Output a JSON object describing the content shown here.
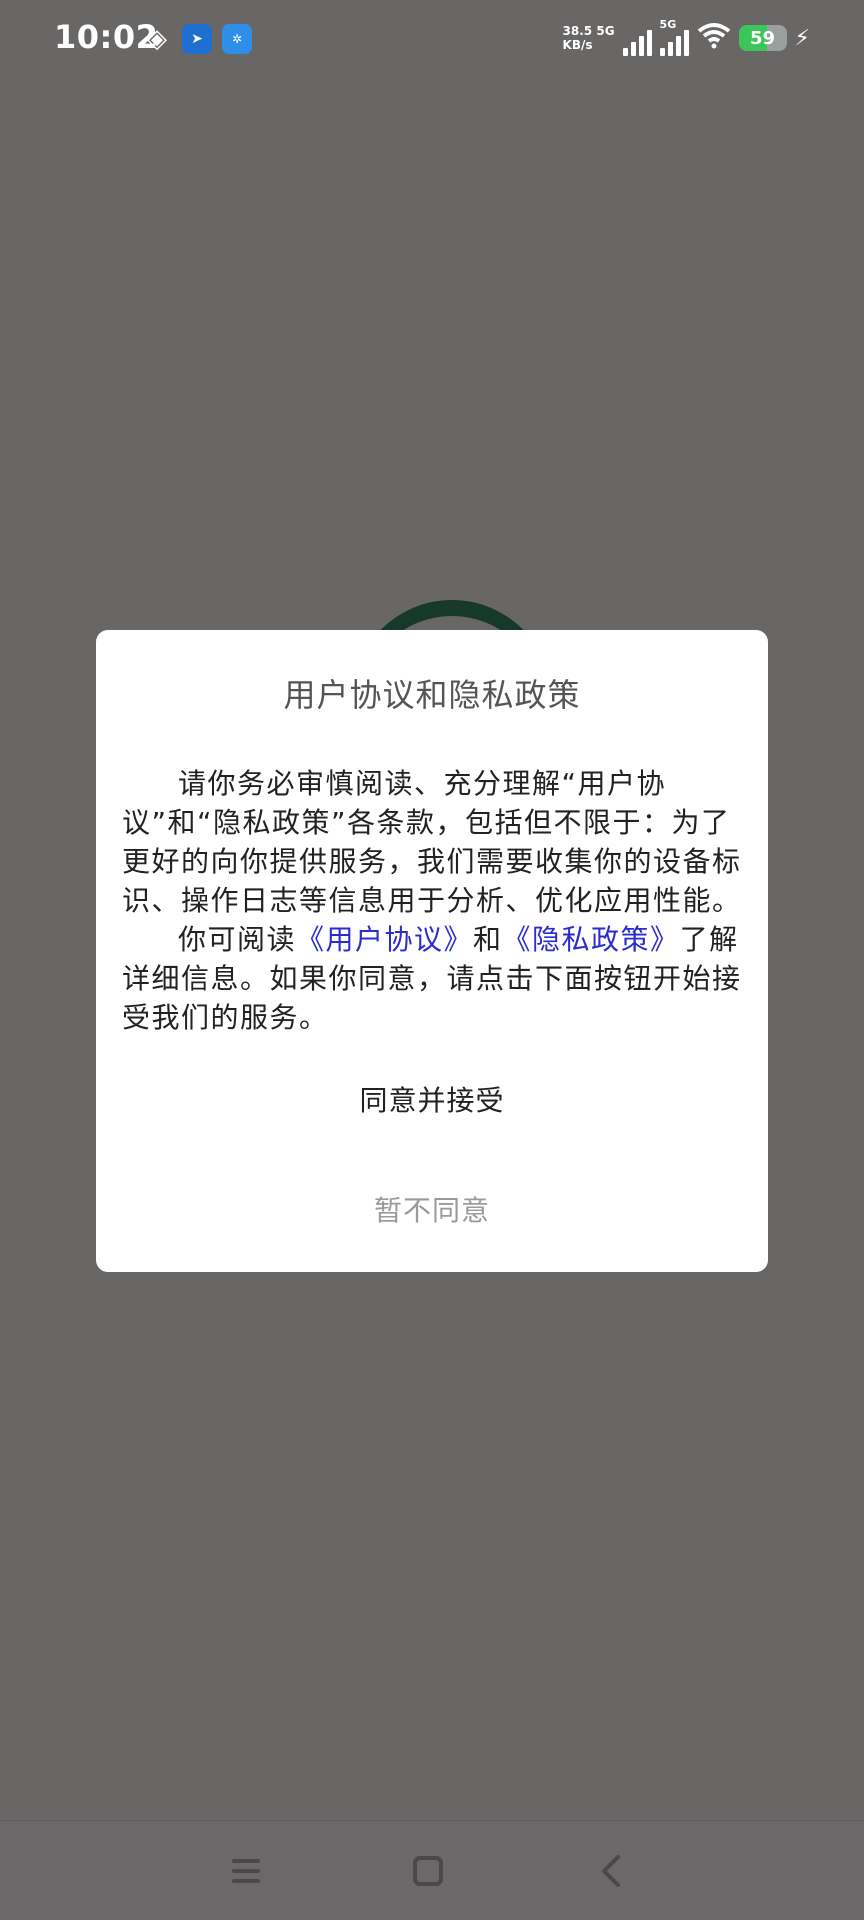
{
  "status_bar": {
    "time": "10:02",
    "net_speed_value": "38.5",
    "net_speed_unit": "KB/s",
    "sim1_label": "5G",
    "sim2_label": "5G",
    "wifi_label": "6",
    "battery_level": "59",
    "icons": [
      "diamond-grid-icon",
      "blue-arrow-app-icon",
      "tp-link-app-icon",
      "wifi-icon",
      "charging-bolt-icon"
    ],
    "tp_link_label": "TP-LINK"
  },
  "dialog": {
    "title": "用户协议和隐私政策",
    "paragraph1": "请你务必审慎阅读、充分理解“用户协议”和“隐私政策”各条款，包括但不限于：为了更好的向你提供服务，我们需要收集你的设备标识、操作日志等信息用于分析、优化应用性能。",
    "paragraph2_prefix": "你可阅读",
    "user_agreement_link": "《用户协议》",
    "paragraph2_and": "和",
    "privacy_policy_link": "《隐私政策》",
    "paragraph2_suffix": "了解详细信息。如果你同意，请点击下面按钮开始接受我们的服务。",
    "accept_label": "同意并接受",
    "decline_label": "暂不同意"
  },
  "nav_bar": {
    "buttons": [
      "menu-icon",
      "home-icon",
      "back-icon"
    ]
  },
  "colors": {
    "overlay_background": "#696666",
    "dialog_background": "#ffffff",
    "link": "#2a2ccf",
    "decline_text": "#9a9a9a",
    "battery_fill": "#3cc65a"
  }
}
